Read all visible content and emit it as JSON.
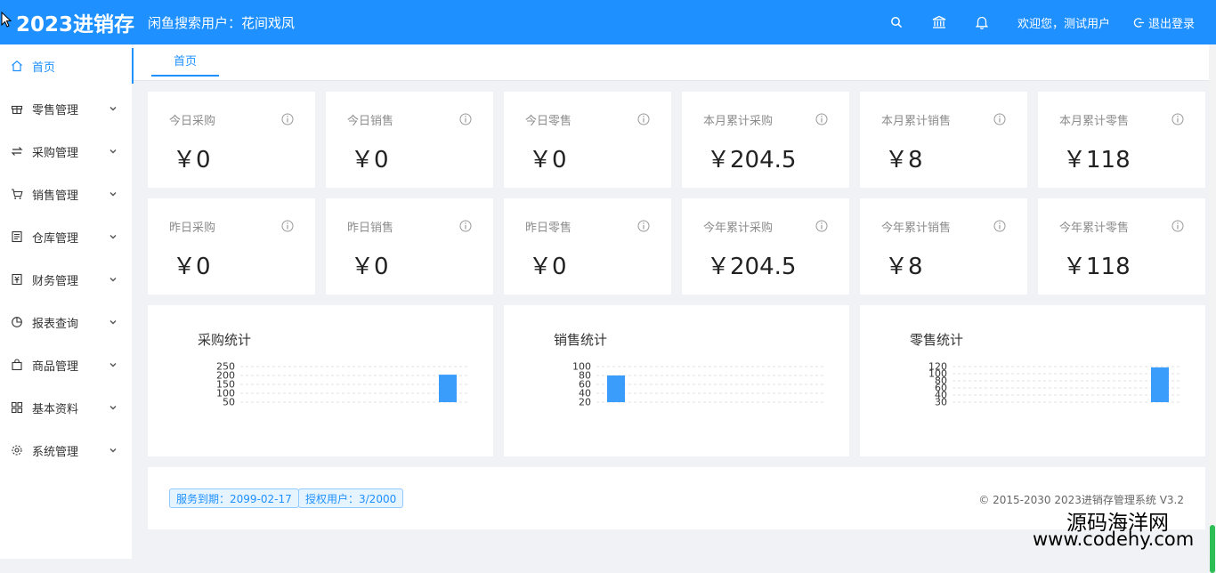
{
  "header": {
    "logo": "2023进销存",
    "idle_text": "闲鱼搜索用户：花间戏凤",
    "welcome": "欢迎您，测试用户",
    "logout": "退出登录",
    "icons": [
      "search-icon",
      "bank-icon",
      "bell-icon"
    ]
  },
  "sidebar": {
    "items": [
      {
        "label": "首页",
        "icon": "home-icon",
        "active": true
      },
      {
        "label": "零售管理",
        "icon": "gift-icon"
      },
      {
        "label": "采购管理",
        "icon": "swap-icon"
      },
      {
        "label": "销售管理",
        "icon": "cart-icon"
      },
      {
        "label": "仓库管理",
        "icon": "warehouse-icon"
      },
      {
        "label": "财务管理",
        "icon": "finance-icon"
      },
      {
        "label": "报表查询",
        "icon": "pie-chart-icon"
      },
      {
        "label": "商品管理",
        "icon": "bag-icon"
      },
      {
        "label": "基本资料",
        "icon": "grid-icon"
      },
      {
        "label": "系统管理",
        "icon": "gear-icon"
      }
    ]
  },
  "tabs": [
    {
      "label": "首页"
    }
  ],
  "stats": [
    {
      "label": "今日采购",
      "value": "￥0"
    },
    {
      "label": "今日销售",
      "value": "￥0"
    },
    {
      "label": "今日零售",
      "value": "￥0"
    },
    {
      "label": "本月累计采购",
      "value": "￥204.5"
    },
    {
      "label": "本月累计销售",
      "value": "￥8"
    },
    {
      "label": "本月累计零售",
      "value": "￥118"
    },
    {
      "label": "昨日采购",
      "value": "￥0"
    },
    {
      "label": "昨日销售",
      "value": "￥0"
    },
    {
      "label": "昨日零售",
      "value": "￥0"
    },
    {
      "label": "今年累计采购",
      "value": "￥204.5"
    },
    {
      "label": "今年累计销售",
      "value": "￥8"
    },
    {
      "label": "今年累计零售",
      "value": "￥118"
    }
  ],
  "charts": [
    {
      "title": "采购统计",
      "ticks": [
        "250",
        "200",
        "150",
        "100",
        "50"
      ],
      "ymin": 50,
      "ymax": 250,
      "bar_value": 204.5,
      "bar_position": "right",
      "color": "#3a9dfc"
    },
    {
      "title": "销售统计",
      "ticks": [
        "100",
        "80",
        "60",
        "40",
        "20"
      ],
      "ymin": 20,
      "ymax": 100,
      "bar_value": 80,
      "bar_position": "left",
      "color": "#3a9dfc"
    },
    {
      "title": "零售统计",
      "ticks": [
        "120",
        "100",
        "80",
        "60",
        "40",
        "30"
      ],
      "ymin": 30,
      "ymax": 120,
      "bar_value": 118,
      "bar_position": "right",
      "color": "#3a9dfc"
    }
  ],
  "footer": {
    "service_badge": "服务到期：2099-02-17",
    "license_badge": "授权用户：3/2000",
    "copyright": "© 2015-2030 2023进销存管理系统 V3.2"
  },
  "watermark": {
    "line1": "源码海洋网",
    "line2": "www.codehy.com"
  },
  "colors": {
    "primary": "#1e90ff",
    "bar": "#3a9dfc"
  }
}
